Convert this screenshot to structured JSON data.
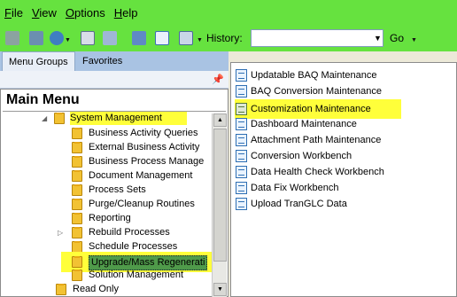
{
  "menubar": {
    "items": [
      {
        "underline": "F",
        "rest": "ile"
      },
      {
        "underline": "V",
        "rest": "iew"
      },
      {
        "underline": "O",
        "rest": "ptions"
      },
      {
        "underline": "H",
        "rest": "elp"
      }
    ]
  },
  "toolbar": {
    "history_label": "History:",
    "history_value": "",
    "go_label": "Go",
    "icons": [
      "tree-icon",
      "network-icon",
      "globe-icon",
      "card-icon",
      "document-icon",
      "people-icon",
      "search-document-icon",
      "tools-icon"
    ]
  },
  "tabs": {
    "menu_groups": "Menu Groups",
    "favorites": "Favorites"
  },
  "tree": {
    "title": "Main Menu",
    "items": [
      {
        "label": "System Management",
        "highlighted": true
      },
      {
        "label": "Business Activity Queries"
      },
      {
        "label": "External Business Activity"
      },
      {
        "label": "Business Process Manage"
      },
      {
        "label": "Document Management"
      },
      {
        "label": "Process Sets"
      },
      {
        "label": "Purge/Cleanup Routines"
      },
      {
        "label": "Reporting"
      },
      {
        "label": "Rebuild Processes"
      },
      {
        "label": "Schedule Processes"
      },
      {
        "label": "Upgrade/Mass Regenerati",
        "highlighted": true
      },
      {
        "label": "Solution Management"
      },
      {
        "label": "Read Only"
      }
    ]
  },
  "list": {
    "items": [
      {
        "label": "Updatable BAQ Maintenance"
      },
      {
        "label": "BAQ Conversion Maintenance"
      },
      {
        "label": "Customization Maintenance",
        "highlighted": true
      },
      {
        "label": "Dashboard Maintenance"
      },
      {
        "label": "Attachment Path Maintenance"
      },
      {
        "label": "Conversion Workbench"
      },
      {
        "label": "Data Health Check Workbench"
      },
      {
        "label": "Data Fix Workbench"
      },
      {
        "label": "Upload TranGLC Data"
      }
    ]
  },
  "colors": {
    "toolbar_bg": "#66e23f",
    "highlight": "#ffff3a"
  }
}
